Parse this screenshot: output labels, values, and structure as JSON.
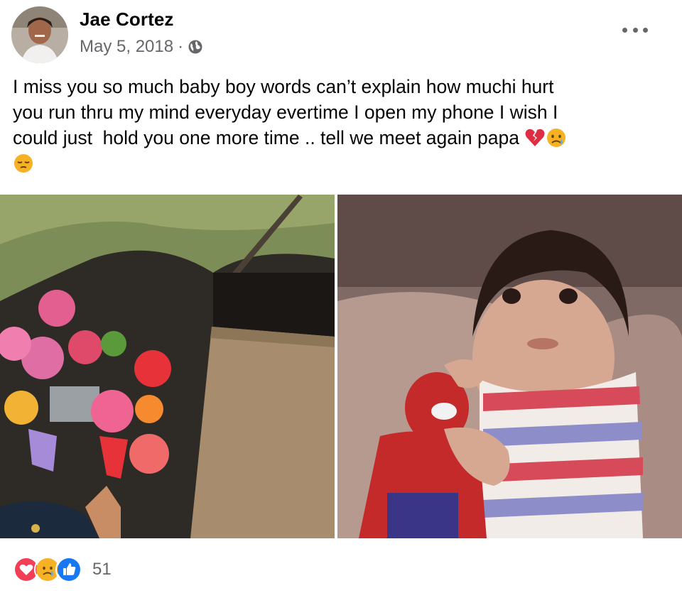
{
  "post": {
    "author": "Jae Cortez",
    "date": "May 5, 2018",
    "separator": "·",
    "privacy_icon": "globe-icon",
    "text_line1": "I miss you so much baby boy words can’t explain how muchi hurt",
    "text_line2": "you run thru my mind everyday evertime I open my phone I wish I",
    "text_line3": "could just  hold you one more time .. tell we meet again papa ",
    "emojis": [
      "broken-heart-emoji",
      "crying-face-emoji",
      "pensive-face-emoji"
    ]
  },
  "photos": [
    {
      "name": "grave-flowers-photo"
    },
    {
      "name": "baby-with-toy-photo"
    }
  ],
  "reactions": {
    "icons": [
      "love-reaction-icon",
      "care-reaction-icon",
      "like-reaction-icon"
    ],
    "count": "51"
  },
  "colors": {
    "text": "#050505",
    "secondary_text": "#65676b",
    "like_blue": "#1877f2",
    "love_red": "#f33e58",
    "care_yellow": "#f7b125"
  }
}
